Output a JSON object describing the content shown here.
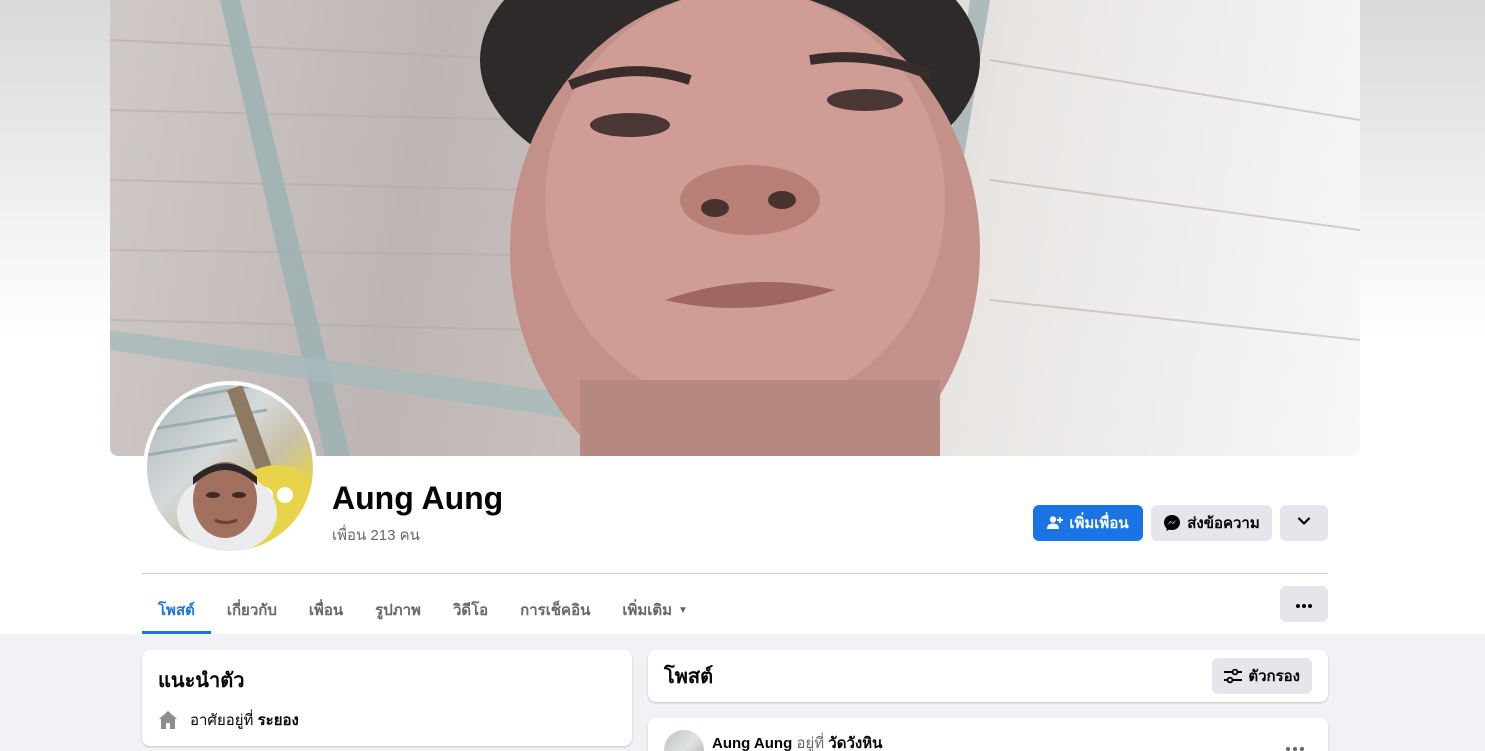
{
  "profile": {
    "name": "Aung Aung",
    "friends_text": "เพื่อน 213 คน"
  },
  "actions": {
    "add_friend": "เพิ่มเพื่อน",
    "message": "ส่งข้อความ"
  },
  "tabs": [
    {
      "label": "โพสต์",
      "active": true
    },
    {
      "label": "เกี่ยวกับ"
    },
    {
      "label": "เพื่อน"
    },
    {
      "label": "รูปภาพ"
    },
    {
      "label": "วิดีโอ"
    },
    {
      "label": "การเช็คอิน"
    },
    {
      "label": "เพิ่มเติม"
    }
  ],
  "intro": {
    "title": "แนะนำตัว",
    "lives_prefix": "อาศัยอยู่ที่",
    "lives_place": "ระยอง"
  },
  "posts": {
    "title": "โพสต์",
    "filter_label": "ตัวกรอง",
    "first_post": {
      "author": "Aung Aung",
      "at_text": "อยู่ที่",
      "place": "วัดวังหิน"
    }
  },
  "colors": {
    "accent": "#1b74e4",
    "secondary_button": "#e4e6eb",
    "page_bg": "#f0f2f5"
  }
}
